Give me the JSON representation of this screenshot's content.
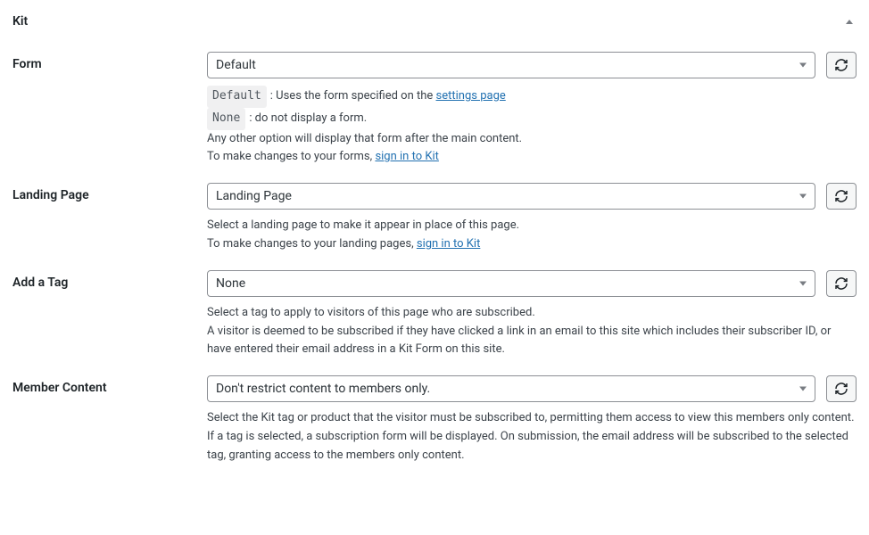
{
  "panel": {
    "title": "Kit"
  },
  "fields": {
    "form": {
      "label": "Form",
      "value": "Default",
      "help": {
        "badge1": "Default",
        "text1": ": Uses the form specified on the ",
        "link1": "settings page",
        "badge2": "None",
        "text2": ": do not display a form.",
        "text3": "Any other option will display that form after the main content.",
        "text4": "To make changes to your forms, ",
        "link2": "sign in to Kit"
      }
    },
    "landing": {
      "label": "Landing Page",
      "value": "Landing Page",
      "help": {
        "text1": "Select a landing page to make it appear in place of this page.",
        "text2": "To make changes to your landing pages, ",
        "link1": "sign in to Kit"
      }
    },
    "tag": {
      "label": "Add a Tag",
      "value": "None",
      "help": {
        "text1": "Select a tag to apply to visitors of this page who are subscribed.",
        "text2": "A visitor is deemed to be subscribed if they have clicked a link in an email to this site which includes their subscriber ID, or have entered their email address in a Kit Form on this site."
      }
    },
    "member": {
      "label": "Member Content",
      "value": "Don't restrict content to members only.",
      "help": {
        "text1": "Select the Kit tag or product that the visitor must be subscribed to, permitting them access to view this members only content.",
        "text2": "If a tag is selected, a subscription form will be displayed. On submission, the email address will be subscribed to the selected tag, granting access to the members only content."
      }
    }
  }
}
